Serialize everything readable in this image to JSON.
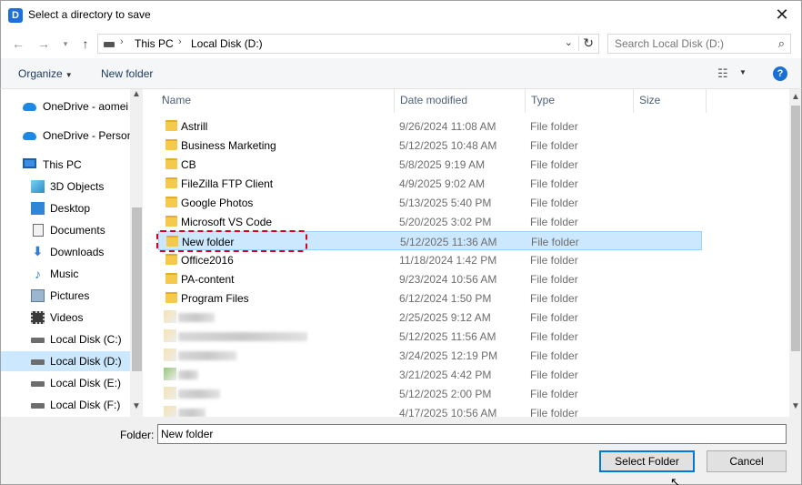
{
  "window": {
    "title": "Select a directory to save",
    "close": "✕",
    "app_icon": "D"
  },
  "address": {
    "parts": [
      "This PC",
      "Local Disk (D:)"
    ],
    "separator": "›",
    "search_placeholder": "Search Local Disk (D:)"
  },
  "toolbar": {
    "organize": "Organize",
    "new_folder": "New folder",
    "help": "?"
  },
  "nav": {
    "items": [
      {
        "label": "OneDrive - aomei",
        "icon": "cloud-icon"
      },
      {
        "label": "OneDrive - Personal",
        "icon": "cloud-icon"
      },
      {
        "label": "This PC",
        "icon": "computer-icon"
      },
      {
        "label": "3D Objects",
        "icon": "3d-objects-icon"
      },
      {
        "label": "Desktop",
        "icon": "desktop-icon"
      },
      {
        "label": "Documents",
        "icon": "documents-icon"
      },
      {
        "label": "Downloads",
        "icon": "downloads-icon"
      },
      {
        "label": "Music",
        "icon": "music-icon"
      },
      {
        "label": "Pictures",
        "icon": "pictures-icon"
      },
      {
        "label": "Videos",
        "icon": "videos-icon"
      },
      {
        "label": "Local Disk (C:)",
        "icon": "drive-icon"
      },
      {
        "label": "Local Disk (D:)",
        "icon": "drive-icon",
        "selected": true
      },
      {
        "label": "Local Disk (E:)",
        "icon": "drive-icon"
      },
      {
        "label": "Local Disk (F:)",
        "icon": "drive-icon"
      }
    ]
  },
  "columns": {
    "name": "Name",
    "date": "Date modified",
    "type": "Type",
    "size": "Size"
  },
  "files": [
    {
      "name": "Astrill",
      "date": "9/26/2024 11:08 AM",
      "type": "File folder"
    },
    {
      "name": "Business Marketing",
      "date": "5/12/2025 10:48 AM",
      "type": "File folder"
    },
    {
      "name": "CB",
      "date": "5/8/2025 9:19 AM",
      "type": "File folder"
    },
    {
      "name": "FileZilla FTP Client",
      "date": "4/9/2025 9:02 AM",
      "type": "File folder"
    },
    {
      "name": "Google Photos",
      "date": "5/13/2025 5:40 PM",
      "type": "File folder"
    },
    {
      "name": "Microsoft VS Code",
      "date": "5/20/2025 3:02 PM",
      "type": "File folder"
    },
    {
      "name": "New folder",
      "date": "5/12/2025 11:36 AM",
      "type": "File folder",
      "selected": true
    },
    {
      "name": "Office2016",
      "date": "11/18/2024 1:42 PM",
      "type": "File folder"
    },
    {
      "name": "PA-content",
      "date": "9/23/2024 10:56 AM",
      "type": "File folder"
    },
    {
      "name": "Program Files",
      "date": "6/12/2024 1:50 PM",
      "type": "File folder"
    },
    {
      "name": "",
      "date": "2/25/2025 9:12 AM",
      "type": "File folder",
      "blurred": true
    },
    {
      "name": "",
      "date": "5/12/2025 11:56 AM",
      "type": "File folder",
      "blurred": true
    },
    {
      "name": "",
      "date": "3/24/2025 12:19 PM",
      "type": "File folder",
      "blurred": true
    },
    {
      "name": "",
      "date": "3/21/2025 4:42 PM",
      "type": "File folder",
      "blurred": true
    },
    {
      "name": "",
      "date": "5/12/2025 2:00 PM",
      "type": "File folder",
      "blurred": true
    },
    {
      "name": "",
      "date": "4/17/2025 10:56 AM",
      "type": "File folder",
      "blurred": true
    }
  ],
  "footer": {
    "folder_label": "Folder:",
    "folder_value": "New folder",
    "select_button": "Select Folder",
    "cancel_button": "Cancel"
  },
  "colors": {
    "selection": "#cce8ff",
    "accent": "#0078d7",
    "highlight_dashes": "#d9001b"
  }
}
